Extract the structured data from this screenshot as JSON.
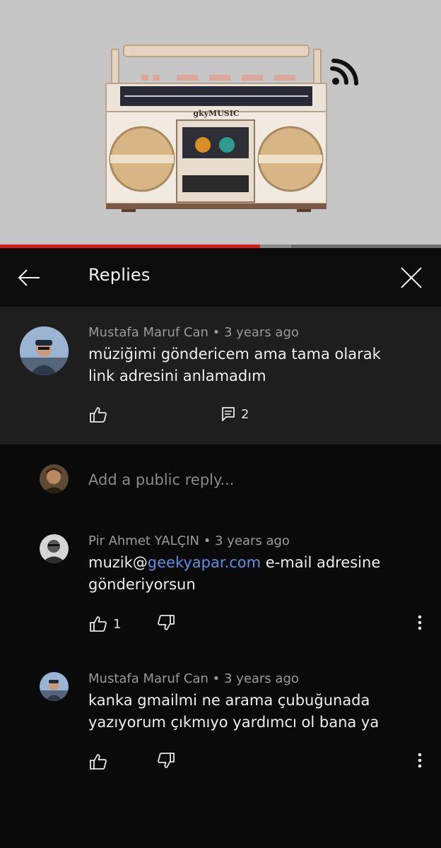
{
  "video": {
    "brand_text": "gkyMUSIC",
    "progress_percent": 59,
    "buffered_percent": 66
  },
  "header": {
    "title": "Replies"
  },
  "parent_comment": {
    "author": "Mustafa Maruf Can",
    "time": "3 years ago",
    "text_line1": "müziğimi göndericem ama tama olarak",
    "text_line2": "link adresini anlamadım",
    "reply_count": "2"
  },
  "reply_input": {
    "placeholder": "Add a public reply..."
  },
  "replies": [
    {
      "author": "Pir Ahmet YALÇIN",
      "time": "3 years ago",
      "text_prefix": "muzik@",
      "text_link": "geekyapar.com",
      "text_suffix": " e-mail adresine",
      "text_line2": "gönderiyorsun",
      "like_count": "1"
    },
    {
      "author": "Mustafa Maruf Can",
      "time": "3 years ago",
      "text_line1": "kanka gmailmi ne arama çubuğunada",
      "text_line2": "yazıyorum çıkmıyo yardımcı ol bana ya",
      "like_count": ""
    }
  ],
  "icons": [
    "arrow-left-icon",
    "close-icon",
    "thumbs-up-icon",
    "thumbs-down-icon",
    "comment-icon",
    "more-vert-icon",
    "rss-icon"
  ],
  "colors": {
    "accent": "#d51b1b",
    "link": "#5f8ee6",
    "background": "#0a0a0a",
    "panel": "#1e1e1e"
  }
}
